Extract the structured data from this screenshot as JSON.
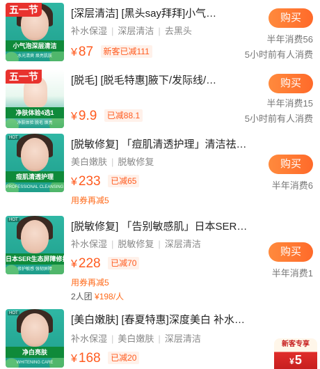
{
  "items": [
    {
      "thumb_festival": "五一节",
      "thumb_band": "小气泡深层清洁",
      "thumb_sub": "水光清爽 焕亮肌肤",
      "title": "[深层清洁] [黑头say拜拜]小气…",
      "tags": [
        "补水保湿",
        "深层清洁",
        "去黑头"
      ],
      "currency": "¥",
      "price": "87",
      "discount": "新客已减111",
      "buy_label": "购买",
      "meta_line1": "半年消费56",
      "meta_line2": "5小时前有人消费"
    },
    {
      "thumb_festival": "五一节",
      "thumb_band": "净肤体验4选1",
      "thumb_sub": "净肤体验 脱毛 焕亮",
      "title": "[脱毛] [脱毛特惠]腋下/发际线/…",
      "tags": [],
      "currency": "¥",
      "price": "9.9",
      "discount": "已减88.1",
      "buy_label": "购买",
      "meta_line1": "半年消费15",
      "meta_line2": "5小时前有人消费"
    },
    {
      "thumb_hot": "HOT",
      "thumb_band": "痘肌清透护理",
      "thumb_sub": "PROFESSIONAL CLEANSING",
      "title": "[脱敏修复] 「痘肌清透护理」清洁祛…",
      "tags": [
        "美白嫩肤",
        "脱敏修复"
      ],
      "currency": "¥",
      "price": "233",
      "discount": "已减65",
      "coupon": "用券再减5",
      "buy_label": "购买",
      "meta_line1": "半年消费6"
    },
    {
      "thumb_hot": "HOT",
      "thumb_band": "日本SER生态屏障修护",
      "thumb_sub": "修护敏感 强韧屏障",
      "title": "[脱敏修复] 「告别敏感肌」日本SER…",
      "tags": [
        "补水保湿",
        "脱敏修复",
        "深层清洁"
      ],
      "currency": "¥",
      "price": "228",
      "discount": "已减70",
      "coupon": "用券再减5",
      "group_prefix": "2人团",
      "group_price": "¥198/人",
      "buy_label": "购买",
      "meta_line1": "半年消费1"
    },
    {
      "thumb_hot": "HOT",
      "thumb_band": "净白亮肤",
      "thumb_sub": "WHITENING CARE",
      "title": "[美白嫩肤] [春夏特惠]深度美白 补水…",
      "tags": [
        "补水保湿",
        "美白嫩肤",
        "深层清洁"
      ],
      "currency": "¥",
      "price": "168",
      "discount": "已减20"
    }
  ],
  "promo": {
    "label": "新客专享",
    "currency": "¥",
    "amount": "5"
  },
  "colors": {
    "accent": "#ff5b1f",
    "buy_gradient_start": "#ff8a3d",
    "buy_gradient_end": "#ff6a2a",
    "thumb_green": "#2fb7a4",
    "festival_red": "#e8322e"
  }
}
